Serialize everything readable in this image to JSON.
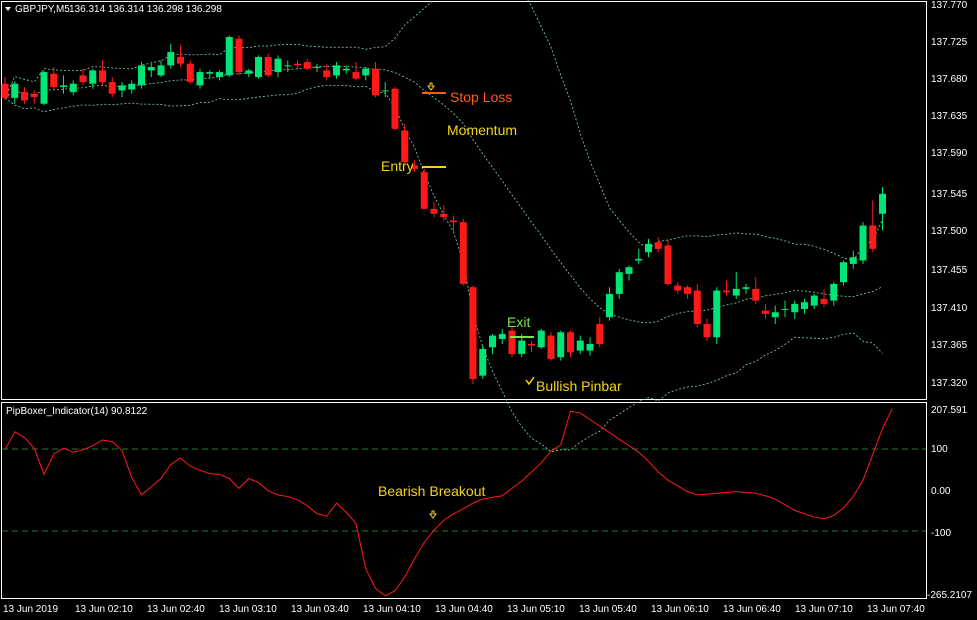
{
  "window": {
    "symbol_label": "GBPJPY,M5",
    "ohlc": "136.314 136.314 136.298 136.298"
  },
  "colors": {
    "background": "#000000",
    "bull": "#00E676",
    "bear": "#FF1A1A",
    "band": "#7ED9A8",
    "indicator": "#FF1A1A",
    "level_line": "#1E7A2E",
    "annotation": "#F5D418",
    "stoploss": "#FF5A1A",
    "exit": "#7EE04A",
    "frame": "#FFFFFF"
  },
  "main": {
    "price_axis": [
      "137.770",
      "137.725",
      "137.680",
      "137.635",
      "137.590",
      "137.545",
      "137.500",
      "137.455",
      "137.410",
      "137.365",
      "137.320"
    ],
    "annotations": {
      "stop_loss": "Stop Loss",
      "momentum": "Momentum",
      "entry": "Entry",
      "exit": "Exit",
      "bullish_pinbar": "Bullish Pinbar"
    }
  },
  "indicator": {
    "title": "PipBoxer_Indicator(14) 90.8122",
    "axis_labels": [
      "207.591",
      "100",
      "0.00",
      "-100",
      "-265.2107"
    ],
    "annotation": "Bearish Breakout"
  },
  "time_axis": [
    "13 Jun 2019",
    "13 Jun 02:10",
    "13 Jun 02:40",
    "13 Jun 03:10",
    "13 Jun 03:40",
    "13 Jun 04:10",
    "13 Jun 04:40",
    "13 Jun 05:10",
    "13 Jun 05:40",
    "13 Jun 06:10",
    "13 Jun 06:40",
    "13 Jun 07:10",
    "13 Jun 07:40"
  ],
  "chart_data": {
    "type": "candlestick",
    "candles": [
      [
        137.672,
        137.68,
        137.652,
        137.655
      ],
      [
        137.655,
        137.675,
        137.648,
        137.672
      ],
      [
        137.662,
        137.668,
        137.648,
        137.652
      ],
      [
        137.66,
        137.664,
        137.648,
        137.656
      ],
      [
        137.648,
        137.688,
        137.646,
        137.686
      ],
      [
        137.684,
        137.692,
        137.664,
        137.668
      ],
      [
        137.668,
        137.682,
        137.66,
        137.67
      ],
      [
        137.662,
        137.676,
        137.658,
        137.672
      ],
      [
        137.682,
        137.69,
        137.67,
        137.674
      ],
      [
        137.672,
        137.69,
        137.666,
        137.688
      ],
      [
        137.688,
        137.7,
        137.67,
        137.674
      ],
      [
        137.674,
        137.68,
        137.656,
        137.66
      ],
      [
        137.664,
        137.674,
        137.656,
        137.67
      ],
      [
        137.665,
        137.676,
        137.66,
        137.672
      ],
      [
        137.67,
        137.698,
        137.666,
        137.694
      ],
      [
        137.688,
        137.696,
        137.68,
        137.692
      ],
      [
        137.682,
        137.7,
        137.68,
        137.694
      ],
      [
        137.694,
        137.72,
        137.69,
        137.71
      ],
      [
        137.704,
        137.718,
        137.692,
        137.696
      ],
      [
        137.696,
        137.7,
        137.672,
        137.674
      ],
      [
        137.67,
        137.69,
        137.666,
        137.686
      ],
      [
        137.684,
        137.688,
        137.678,
        137.686
      ],
      [
        137.68,
        137.688,
        137.676,
        137.686
      ],
      [
        137.682,
        137.73,
        137.68,
        137.728
      ],
      [
        137.726,
        137.73,
        137.682,
        137.686
      ],
      [
        137.684,
        137.69,
        137.68,
        137.688
      ],
      [
        137.68,
        137.706,
        137.678,
        137.704
      ],
      [
        137.704,
        137.708,
        137.68,
        137.682
      ],
      [
        137.686,
        137.706,
        137.68,
        137.702
      ],
      [
        137.694,
        137.7,
        137.686,
        137.694
      ],
      [
        137.696,
        137.7,
        137.69,
        137.694
      ],
      [
        137.698,
        137.702,
        137.688,
        137.69
      ],
      [
        137.692,
        137.696,
        137.686,
        137.692
      ],
      [
        137.688,
        137.696,
        137.676,
        137.68
      ],
      [
        137.682,
        137.698,
        137.678,
        137.694
      ],
      [
        137.688,
        137.694,
        137.684,
        137.69
      ],
      [
        137.686,
        137.698,
        137.676,
        137.678
      ],
      [
        137.682,
        137.692,
        137.676,
        137.69
      ],
      [
        137.69,
        137.698,
        137.656,
        137.658
      ],
      [
        137.664,
        137.674,
        137.656,
        137.664
      ],
      [
        137.666,
        137.668,
        137.616,
        137.618
      ],
      [
        137.616,
        137.624,
        137.576,
        137.578
      ],
      [
        137.574,
        137.58,
        137.566,
        137.57
      ],
      [
        137.566,
        137.57,
        137.522,
        137.522
      ],
      [
        137.522,
        137.53,
        137.512,
        137.516
      ],
      [
        137.516,
        137.526,
        137.508,
        137.512
      ],
      [
        137.508,
        137.514,
        137.494,
        137.506
      ],
      [
        137.506,
        137.51,
        137.43,
        137.432
      ],
      [
        137.428,
        137.43,
        137.312,
        137.318
      ],
      [
        137.322,
        137.358,
        137.318,
        137.354
      ],
      [
        137.356,
        137.372,
        137.348,
        137.37
      ],
      [
        137.366,
        137.378,
        137.36,
        137.372
      ],
      [
        137.376,
        137.38,
        137.344,
        137.348
      ],
      [
        137.348,
        137.372,
        137.344,
        137.364
      ],
      [
        137.36,
        137.364,
        137.35,
        137.358
      ],
      [
        137.356,
        137.378,
        137.354,
        137.376
      ],
      [
        137.37,
        137.374,
        137.34,
        137.342
      ],
      [
        137.344,
        137.376,
        137.34,
        137.374
      ],
      [
        137.374,
        137.376,
        137.344,
        137.35
      ],
      [
        137.352,
        137.37,
        137.348,
        137.364
      ],
      [
        137.352,
        137.368,
        137.346,
        137.36
      ],
      [
        137.384,
        137.392,
        137.356,
        137.36
      ],
      [
        137.392,
        137.428,
        137.388,
        137.42
      ],
      [
        137.42,
        137.45,
        137.414,
        137.446
      ],
      [
        137.444,
        137.454,
        137.436,
        137.452
      ],
      [
        137.46,
        137.474,
        137.456,
        137.462
      ],
      [
        137.47,
        137.486,
        137.464,
        137.48
      ],
      [
        137.482,
        137.488,
        137.47,
        137.474
      ],
      [
        137.478,
        137.484,
        137.43,
        137.432
      ],
      [
        137.43,
        137.434,
        137.42,
        137.424
      ],
      [
        137.428,
        137.43,
        137.414,
        137.42
      ],
      [
        137.424,
        137.432,
        137.38,
        137.384
      ],
      [
        137.384,
        137.39,
        137.364,
        137.368
      ],
      [
        137.368,
        137.428,
        137.36,
        137.424
      ],
      [
        137.424,
        137.436,
        137.418,
        137.422
      ],
      [
        137.418,
        137.446,
        137.414,
        137.426
      ],
      [
        137.426,
        137.432,
        137.42,
        137.428
      ],
      [
        137.426,
        137.44,
        137.408,
        137.412
      ],
      [
        137.4,
        137.408,
        137.39,
        137.396
      ],
      [
        137.392,
        137.406,
        137.384,
        137.398
      ],
      [
        137.402,
        137.412,
        137.392,
        137.402
      ],
      [
        137.398,
        137.412,
        137.39,
        137.408
      ],
      [
        137.402,
        137.414,
        137.396,
        137.41
      ],
      [
        137.406,
        137.42,
        137.402,
        137.418
      ],
      [
        137.414,
        137.426,
        137.404,
        137.408
      ],
      [
        137.412,
        137.434,
        137.406,
        137.432
      ],
      [
        137.434,
        137.46,
        137.43,
        137.458
      ],
      [
        137.456,
        137.472,
        137.45,
        137.464
      ],
      [
        137.46,
        137.506,
        137.456,
        137.502
      ],
      [
        137.502,
        137.532,
        137.47,
        137.474
      ],
      [
        137.516,
        137.548,
        137.496,
        137.54
      ]
    ],
    "indicator_values": [
      98,
      142,
      128,
      102,
      38,
      88,
      102,
      92,
      98,
      108,
      122,
      118,
      96,
      30,
      -12,
      8,
      28,
      62,
      78,
      58,
      48,
      40,
      38,
      28,
      4,
      28,
      18,
      -2,
      -12,
      -16,
      -24,
      -38,
      -58,
      -64,
      -32,
      -54,
      -82,
      -192,
      -240,
      -258,
      -246,
      -212,
      -168,
      -128,
      -98,
      -74,
      -58,
      -46,
      -32,
      -22,
      -18,
      -14,
      4,
      22,
      44,
      66,
      95,
      110,
      192,
      188,
      172,
      156,
      140,
      124,
      108,
      92,
      70,
      44,
      24,
      10,
      -4,
      -12,
      -10,
      -8,
      -6,
      -4,
      -6,
      -8,
      -14,
      -22,
      -36,
      -50,
      -58,
      -66,
      -70,
      -62,
      -44,
      -16,
      24,
      86,
      150,
      198
    ],
    "indicator_levels": [
      100,
      -100
    ]
  }
}
